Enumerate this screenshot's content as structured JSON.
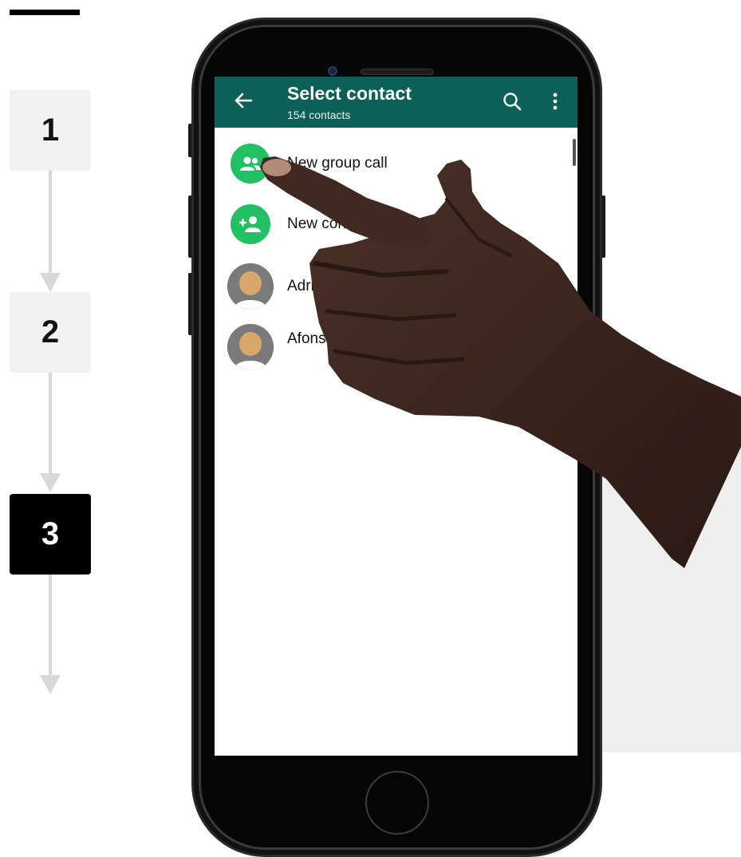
{
  "steps": [
    {
      "number": "1",
      "active": false
    },
    {
      "number": "2",
      "active": false
    },
    {
      "number": "3",
      "active": true
    }
  ],
  "header": {
    "title": "Select contact",
    "subtitle": "154 contacts"
  },
  "rows": [
    {
      "label": "New group call",
      "icon": "group-call-icon"
    },
    {
      "label": "New contact",
      "icon": "add-contact-icon"
    },
    {
      "label": "Adriano",
      "icon": "avatar"
    },
    {
      "label": "Afonso",
      "icon": "avatar"
    }
  ],
  "colors": {
    "header": "#0b6157",
    "accent_green": "#21c063",
    "active_step": "#000000",
    "inactive_step": "#f2f2f2"
  }
}
